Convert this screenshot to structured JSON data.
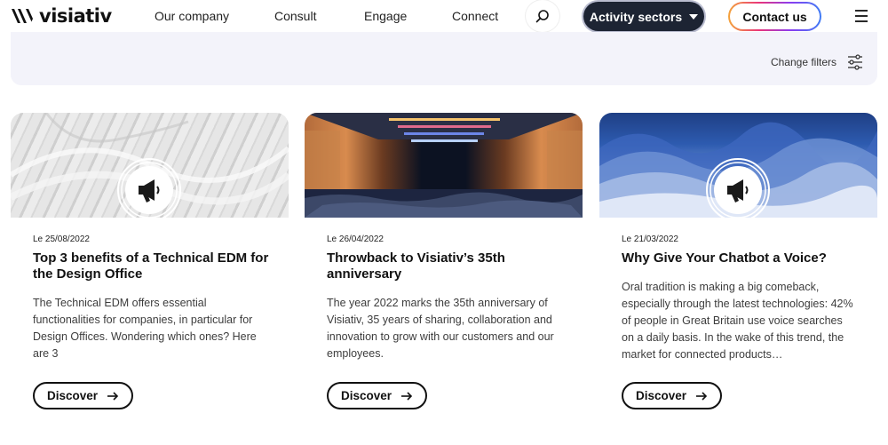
{
  "header": {
    "logo_text": "visiativ",
    "nav": [
      "Our company",
      "Consult",
      "Engage",
      "Connect"
    ],
    "activity_label": "Activity sectors",
    "contact_label": "Contact us"
  },
  "filters": {
    "label": "Change filters"
  },
  "cards": [
    {
      "date": "Le 25/08/2022",
      "title": "Top 3 benefits of a Technical EDM for the Design Office",
      "description": "The Technical EDM offers essential functionalities for companies, in particular for Design Offices. Wondering which ones? Here are 3",
      "button": "Discover"
    },
    {
      "date": "Le 26/04/2022",
      "title": "Throwback to Visiativ’s 35th anniversary",
      "description": "The year 2022 marks the 35th anniversary of Visiativ, 35 years of sharing, collaboration and innovation to grow with our customers and our employees.",
      "button": "Discover"
    },
    {
      "date": "Le 21/03/2022",
      "title": "Why Give Your Chatbot a Voice?",
      "description": "Oral tradition is making a big comeback, especially through the latest technologies: 42% of people in Great Britain use voice searches on a daily basis. In the wake of this trend, the market for connected products…",
      "button": "Discover"
    }
  ],
  "colors": {
    "dark": "#1d2433",
    "filter_bg": "#f3f3fa"
  },
  "icons": [
    "logo-mark-icon",
    "search-icon",
    "caret-down-icon",
    "menu-icon",
    "filter-sliders-icon",
    "megaphone-icon",
    "arrow-right-icon"
  ]
}
